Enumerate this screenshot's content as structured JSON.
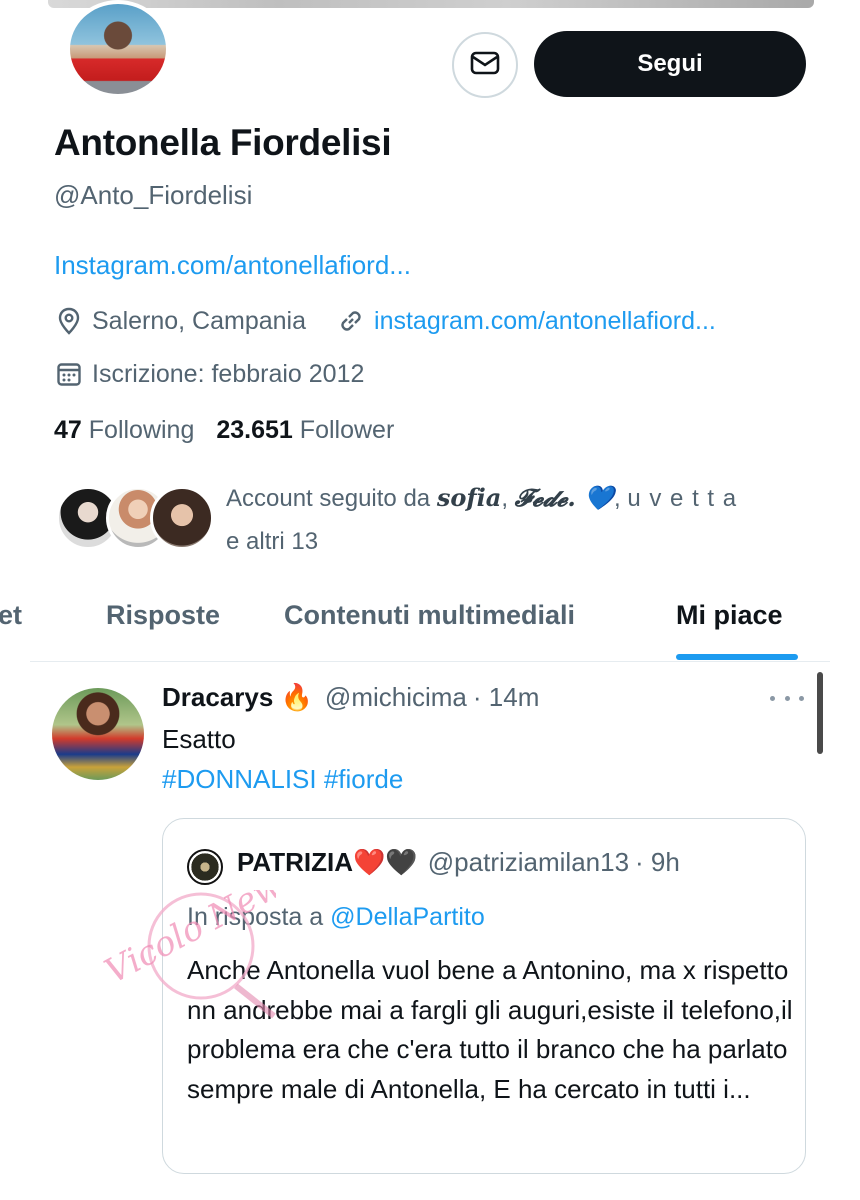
{
  "header": {
    "message_icon": "envelope-icon",
    "follow_label": "Segui"
  },
  "profile": {
    "name": "Antonella Fiordelisi",
    "handle": "@Anto_Fiordelisi",
    "bio_link": "Instagram.com/antonellafiord...",
    "location": "Salerno, Campania",
    "website": "instagram.com/antonellafiord...",
    "joined": "Iscrizione: febbraio 2012",
    "following_count": "47",
    "following_label": "Following",
    "follower_count": "23.651",
    "follower_label": "Follower",
    "followed_by_prefix": "Account seguito da ",
    "followed_by_name1": "𝒔𝒐𝒇𝒊𝒂",
    "followed_by_sep1": ", ",
    "followed_by_name2": "𝓕𝓮𝓭𝓮. 💙",
    "followed_by_sep2": ", ",
    "followed_by_name3": "u v e t t a",
    "followed_by_suffix": "e altri 13"
  },
  "tabs": [
    {
      "label": "et"
    },
    {
      "label": "Risposte"
    },
    {
      "label": "Contenuti multimediali"
    },
    {
      "label": "Mi piace"
    }
  ],
  "active_tab": "Mi piace",
  "tweet": {
    "display_name": "Dracarys 🔥",
    "username": "@michicima",
    "time": "· 14m",
    "text": "Esatto",
    "hashtags": "#DONNALISI #fiorde",
    "quote": {
      "display_name": "PATRIZIA❤️🖤",
      "username": "@patriziamilan13",
      "time": "· 9h",
      "reply_prefix": "In risposta a ",
      "reply_mention": "@DellaPartito",
      "text": "Anche Antonella vuol bene a Antonino, ma x rispetto  nn andrebbe mai a fargli gli auguri,esiste il telefono,il problema era che c'era tutto  il branco che ha parlato sempre male di Antonella, E ha cercato  in  tutti i..."
    }
  },
  "watermark": {
    "text": "Vicolo News"
  },
  "colors": {
    "accent": "#1d9bf0",
    "text": "#0f1419",
    "muted": "#536471",
    "button_dark": "#0f1419"
  }
}
